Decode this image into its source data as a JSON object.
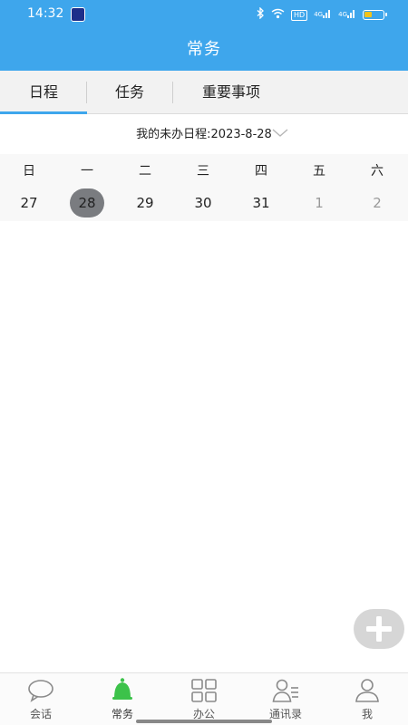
{
  "status_bar": {
    "time": "14:32",
    "bluetooth_icon": "bluetooth-icon",
    "wifi_icon": "wifi-icon",
    "hd_badge": "HD",
    "signal_1": "4G",
    "signal_2": "4G",
    "battery_level": 0.4,
    "battery_color": "#f2c21b"
  },
  "header": {
    "title": "常务",
    "color": "#3ea6ec"
  },
  "tabs": [
    {
      "label": "日程",
      "active": true
    },
    {
      "label": "任务",
      "active": false
    },
    {
      "label": "重要事项",
      "active": false
    }
  ],
  "schedule": {
    "label": "我的未办日程:2023-8-28"
  },
  "week": {
    "weekdays": [
      "日",
      "一",
      "二",
      "三",
      "四",
      "五",
      "六"
    ],
    "days": [
      {
        "label": "27",
        "muted": false,
        "selected": false
      },
      {
        "label": "28",
        "muted": false,
        "selected": true
      },
      {
        "label": "29",
        "muted": false,
        "selected": false
      },
      {
        "label": "30",
        "muted": false,
        "selected": false
      },
      {
        "label": "31",
        "muted": false,
        "selected": false
      },
      {
        "label": "1",
        "muted": true,
        "selected": false
      },
      {
        "label": "2",
        "muted": true,
        "selected": false
      }
    ]
  },
  "fab": {
    "icon": "plus-icon"
  },
  "bottom_nav": [
    {
      "label": "会话",
      "icon": "chat-bubble-icon"
    },
    {
      "label": "常务",
      "icon": "bell-icon",
      "active": true,
      "accent": "#3cc24a"
    },
    {
      "label": "办公",
      "icon": "grid-icon"
    },
    {
      "label": "通讯录",
      "icon": "contacts-icon"
    },
    {
      "label": "我",
      "icon": "person-icon"
    }
  ]
}
